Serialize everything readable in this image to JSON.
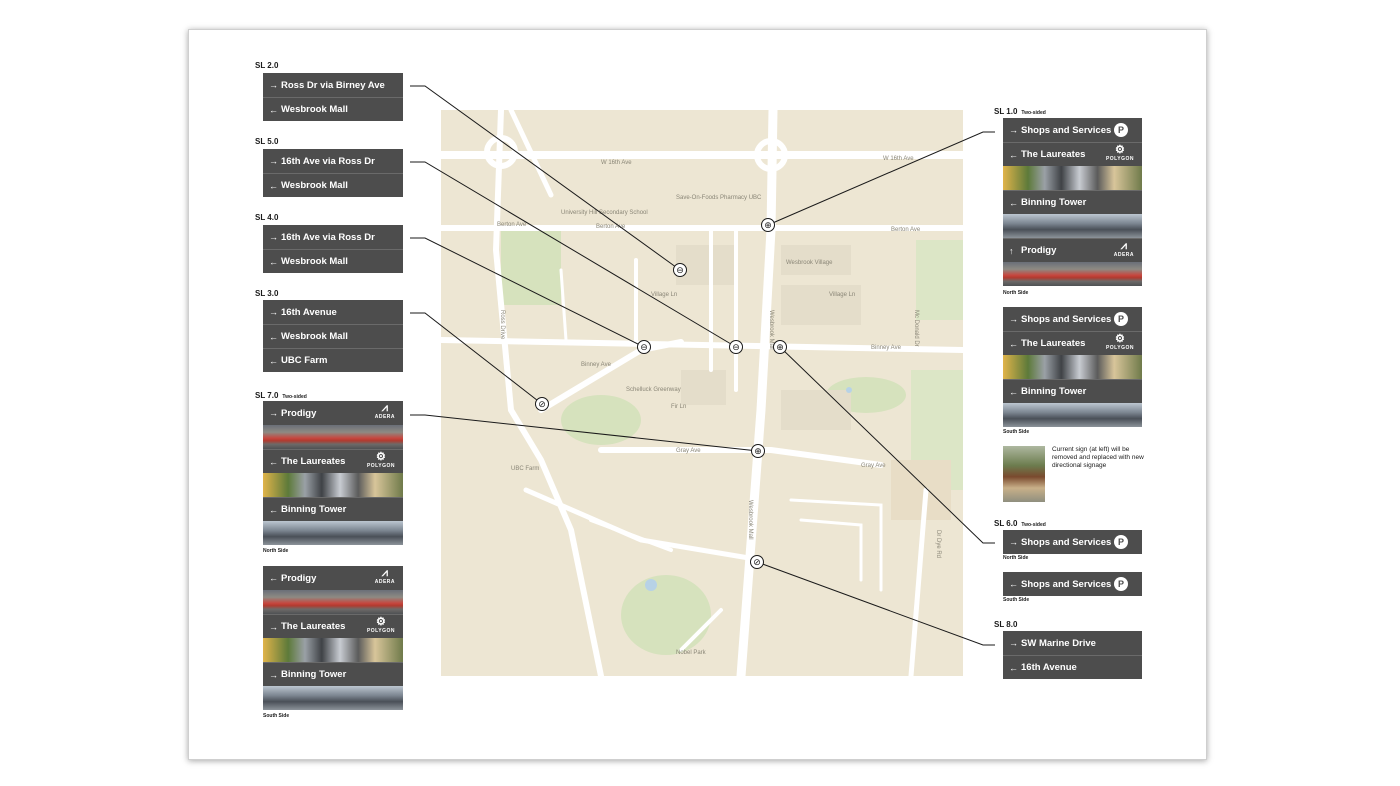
{
  "map": {
    "labels": {
      "w16_left": "W 16th Ave",
      "w16_right": "W 16th Ave",
      "berton_left": "Berton Ave",
      "berton_mid": "Berton Ave",
      "berton_right": "Berton Ave",
      "binney": "Binney Ave",
      "binney_right": "Binney Ave",
      "village": "Village Ln",
      "village_right": "Village Ln",
      "gray": "Gray Ave",
      "gray_right": "Gray Ave",
      "ross": "Ross Drive",
      "ubc_farm": "UBC Farm",
      "wesbrook": "Wesbrook Mall",
      "wesbrook_lower": "Wesbrook Mall",
      "wesbrook_village": "Wesbrook Village",
      "fir": "Fir Ln",
      "school": "University Hill Secondary School",
      "church": "Save-On-Foods Pharmacy UBC",
      "greenway": "Schelluck Greenway",
      "park": "Nobel Park",
      "dorm_label": "Mc Donald Dr",
      "east_label": "Dr Dye Rd"
    }
  },
  "signs": {
    "sl2": {
      "id": "SL 2.0",
      "rows": [
        {
          "arrow": "→",
          "label": "Ross Dr via Birney Ave"
        },
        {
          "arrow": "←",
          "label": "Wesbrook Mall"
        }
      ]
    },
    "sl5": {
      "id": "SL 5.0",
      "rows": [
        {
          "arrow": "→",
          "label": "16th Ave via Ross Dr"
        },
        {
          "arrow": "←",
          "label": "Wesbrook Mall"
        }
      ]
    },
    "sl4": {
      "id": "SL 4.0",
      "rows": [
        {
          "arrow": "→",
          "label": "16th Ave via Ross Dr"
        },
        {
          "arrow": "←",
          "label": "Wesbrook Mall"
        }
      ]
    },
    "sl3": {
      "id": "SL 3.0",
      "rows": [
        {
          "arrow": "→",
          "label": "16th Avenue"
        },
        {
          "arrow": "←",
          "label": "Wesbrook Mall"
        },
        {
          "arrow": "←",
          "label": "UBC Farm"
        }
      ]
    },
    "sl7": {
      "id": "SL 7.0",
      "sub": "Two-sided",
      "north": [
        {
          "arrow": "→",
          "label": "Prodigy",
          "logo": "ADERA"
        },
        {
          "arrow": "←",
          "label": "The Laureates",
          "logo": "POLYGON"
        },
        {
          "arrow": "←",
          "label": "Binning Tower"
        }
      ],
      "north_caption": "North Side",
      "south": [
        {
          "arrow": "←",
          "label": "Prodigy",
          "logo": "ADERA"
        },
        {
          "arrow": "→",
          "label": "The Laureates",
          "logo": "POLYGON"
        },
        {
          "arrow": "→",
          "label": "Binning Tower"
        }
      ],
      "south_caption": "South Side"
    },
    "sl1": {
      "id": "SL 1.0",
      "sub": "Two-sided",
      "north": [
        {
          "arrow": "→",
          "label": "Shops and Services",
          "badge": "P"
        },
        {
          "arrow": "←",
          "label": "The Laureates",
          "logo": "POLYGON"
        },
        {
          "arrow": "←",
          "label": "Binning Tower"
        },
        {
          "arrow": "↑",
          "label": "Prodigy",
          "logo": "ADERA"
        }
      ],
      "north_caption": "North Side",
      "south": [
        {
          "arrow": "→",
          "label": "Shops and Services",
          "badge": "P"
        },
        {
          "arrow": "←",
          "label": "The Laureates",
          "logo": "POLYGON"
        },
        {
          "arrow": "←",
          "label": "Binning Tower"
        }
      ],
      "south_caption": "South Side",
      "note": "Current sign (at left) will be removed and replaced with new directional signage"
    },
    "sl6": {
      "id": "SL 6.0",
      "sub": "Two-sided",
      "north": {
        "arrow": "→",
        "label": "Shops and Services",
        "badge": "P"
      },
      "north_caption": "North Side",
      "south": {
        "arrow": "←",
        "label": "Shops and Services",
        "badge": "P"
      },
      "south_caption": "South Side"
    },
    "sl8": {
      "id": "SL 8.0",
      "rows": [
        {
          "arrow": "→",
          "label": "SW Marine Drive"
        },
        {
          "arrow": "←",
          "label": "16th Avenue"
        }
      ]
    }
  },
  "logos": {
    "adera": "ADERA",
    "polygon": "POLYGON"
  },
  "colors": {
    "sign_bg": "#4d4d4d",
    "map_bg": "#ede6d3",
    "road": "#ffffff",
    "park": "#d6e2bd"
  }
}
